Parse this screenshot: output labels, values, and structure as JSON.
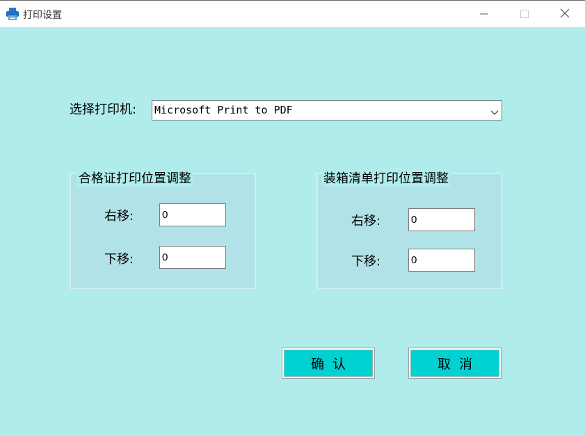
{
  "window": {
    "title": "打印设置",
    "icon": "printer-icon",
    "controls": [
      "minimize-icon",
      "maximize-icon",
      "close-icon"
    ]
  },
  "printer": {
    "label": "选择打印机:",
    "selected": "Microsoft Print to PDF"
  },
  "group_certificate": {
    "title": "合格证打印位置调整",
    "right_label": "右移:",
    "right_value": "0",
    "down_label": "下移:",
    "down_value": "0"
  },
  "group_packing": {
    "title": "装箱清单打印位置调整",
    "right_label": "右移:",
    "right_value": "0",
    "down_label": "下移:",
    "down_value": "0"
  },
  "buttons": {
    "ok": "确  认",
    "cancel": "取  消"
  },
  "colors": {
    "background": "#b0ecec",
    "button": "#00d2d2"
  }
}
